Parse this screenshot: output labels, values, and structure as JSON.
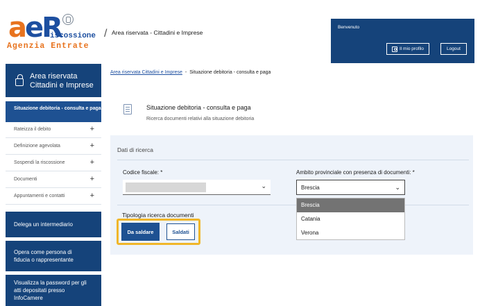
{
  "header": {
    "logo": {
      "big_a": "a",
      "big_e": "e",
      "big_r": "R",
      "riscossione": "iscossione",
      "agenzia": "Agenzia Entrate"
    },
    "breadcrumb_title": "Area riservata - Cittadini e Imprese",
    "separator": "/",
    "welcome": "Benvenuto",
    "profile_button": "Il mio profilo",
    "logout_button": "Logout"
  },
  "sidebar": {
    "title": "Area riservata Cittadini e Imprese",
    "current_item": "Situazione debitoria - consulta e paga",
    "items": [
      {
        "label": "Rateizza il debito"
      },
      {
        "label": "Definizione agevolata"
      },
      {
        "label": "Sospendi la riscossione"
      },
      {
        "label": "Documenti"
      },
      {
        "label": "Appuntamenti e contatti"
      }
    ],
    "expand_symbol": "+",
    "blue_items": [
      {
        "label": "Delega un intermediario"
      },
      {
        "label": "Opera come persona di fiducia o rappresentante"
      },
      {
        "label": "Visualizza la password per gli atti depositati presso InfoCamere"
      }
    ]
  },
  "breadcrumb": {
    "link": "Area riservata Cittadini e Imprese",
    "separator": "-",
    "current": "Situazione debitoria - consulta e paga"
  },
  "page": {
    "title": "Situazione debitoria - consulta e paga",
    "subtitle": "Ricerca documenti relativi alla situazione debitoria"
  },
  "search": {
    "section_title": "Dati di ricerca",
    "codice_fiscale_label": "Codice fiscale: *",
    "codice_fiscale_value": "",
    "ambito_label": "Ambito provinciale con presenza di documenti: *",
    "ambito_value": "Brescia",
    "ambito_options": [
      "Brescia",
      "Catania",
      "Verona"
    ],
    "ambito_highlighted_option": "Brescia",
    "tipologia_label": "Tipologia ricerca documenti",
    "btn_da_saldare": "Da saldare",
    "btn_saldati": "Saldati",
    "highlight_color": "#f0b62a"
  },
  "colors": {
    "brand_blue": "#15437a",
    "accent_orange": "#e8731e",
    "panel_bg": "#eef3fa"
  }
}
